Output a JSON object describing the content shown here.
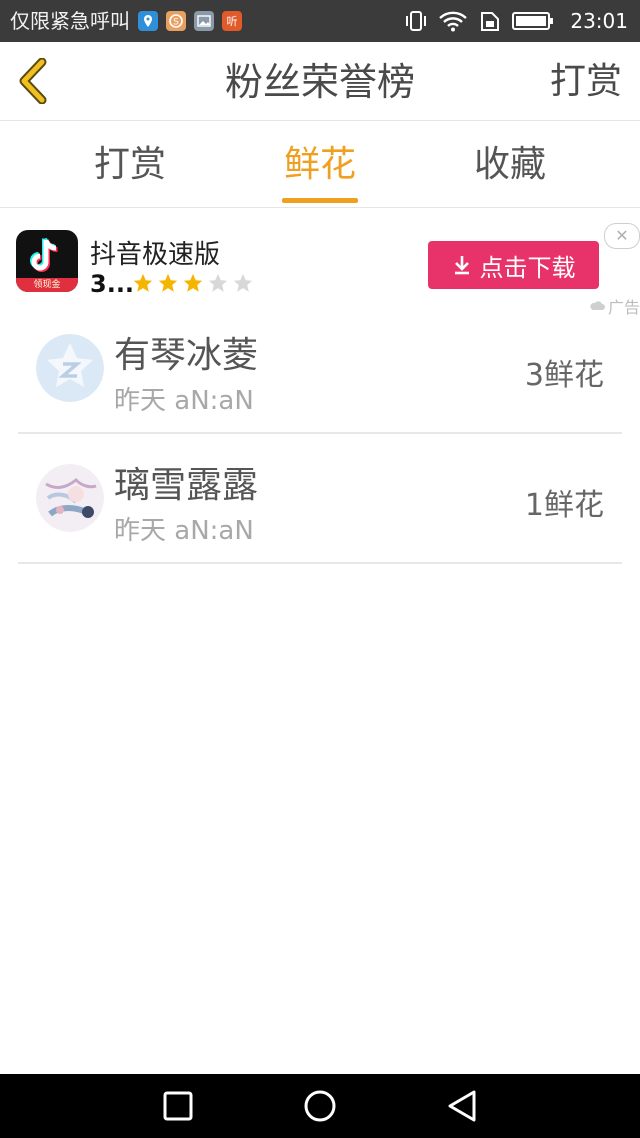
{
  "status_bar": {
    "carrier": "仅限紧急呼叫",
    "time": "23:01",
    "listen_badge": "听"
  },
  "header": {
    "title": "粉丝荣誉榜",
    "action": "打赏"
  },
  "tabs": [
    {
      "label": "打赏",
      "active": false
    },
    {
      "label": "鲜花",
      "active": true
    },
    {
      "label": "收藏",
      "active": false
    }
  ],
  "ad": {
    "app_name": "抖音极速版",
    "rating_text": "3...",
    "rating": 3,
    "rating_max": 5,
    "icon_band_text": "领现金",
    "download_label": "点击下载",
    "close_label": "✕",
    "tag": "广告"
  },
  "list": [
    {
      "name": "有琴冰菱",
      "time": "昨天 aN:aN",
      "count": "3鲜花",
      "avatar": "default-star-avatar"
    },
    {
      "name": "璃雪露露",
      "time": "昨天 aN:aN",
      "count": "1鲜花",
      "avatar": "illustration-avatar"
    }
  ],
  "colors": {
    "accent": "#f0a020",
    "download_button": "#e8336a",
    "status_bar": "#3b3b3b"
  }
}
